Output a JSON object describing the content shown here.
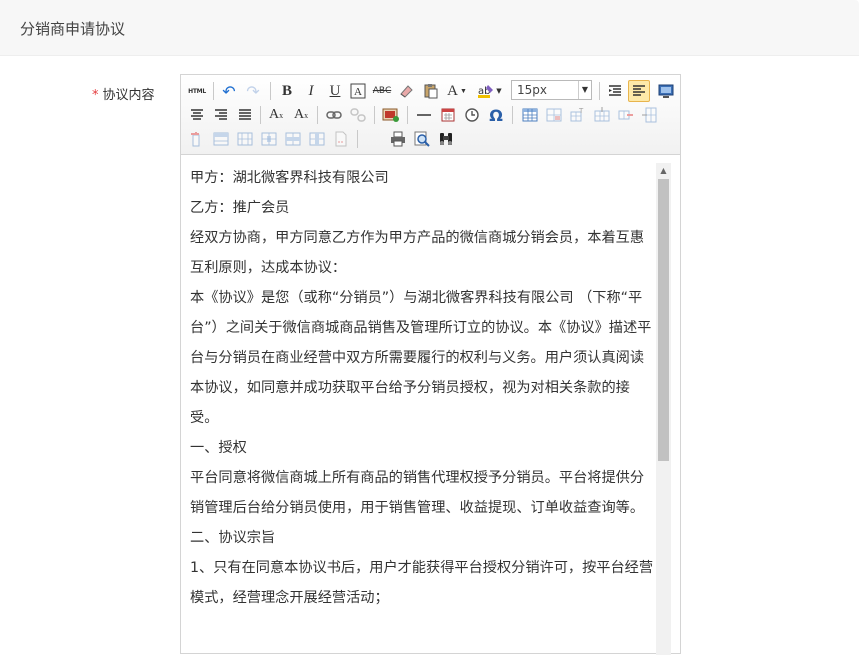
{
  "header": {
    "title": "分销商申请协议"
  },
  "form": {
    "required_mark": "*",
    "label": "协议内容"
  },
  "toolbar": {
    "html_label": "HTML",
    "bold_label": "B",
    "italic_label": "I",
    "underline_label": "U",
    "font_size_value": "15px",
    "font_color_label": "A",
    "special_char_label": "Ω"
  },
  "content": {
    "paragraphs": [
      "甲方：湖北微客界科技有限公司",
      "乙方：推广会员",
      "经双方协商，甲方同意乙方作为甲方产品的微信商城分销会员，本着互惠互利原则，达成本协议：",
      "本《协议》是您（或称“分销员”）与湖北微客界科技有限公司 （下称“平台”）之间关于微信商城商品销售及管理所订立的协议。本《协议》描述平台与分销员在商业经营中双方所需要履行的权利与义务。用户须认真阅读本协议，如同意并成功获取平台给予分销员授权，视为对相关条款的接受。",
      "一、授权",
      "平台同意将微信商城上所有商品的销售代理权授予分销员。平台将提供分销管理后台给分销员使用，用于销售管理、收益提现、订单收益查询等。",
      "二、协议宗旨",
      "1、只有在同意本协议书后，用户才能获得平台授权分销许可，按平台经营模式，经营理念开展经营活动；"
    ]
  },
  "colors": {
    "required": "#e4393c",
    "active_button": "#fde9a9",
    "header_bg": "#f7f7f7"
  }
}
